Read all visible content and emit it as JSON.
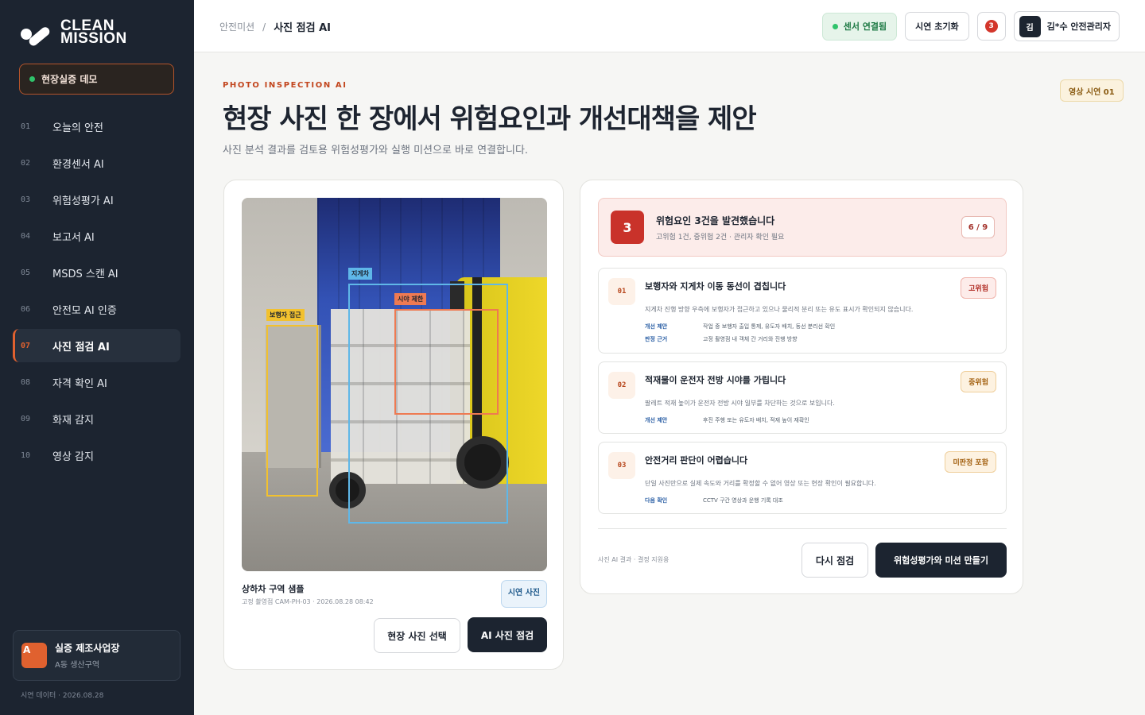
{
  "brand": {
    "line1": "CLEAN",
    "line2": "MISSION"
  },
  "demo_chip": "현장실증 데모",
  "nav": [
    {
      "num": "01",
      "label": "오늘의 안전"
    },
    {
      "num": "02",
      "label": "환경센서 AI"
    },
    {
      "num": "03",
      "label": "위험성평가 AI"
    },
    {
      "num": "04",
      "label": "보고서 AI"
    },
    {
      "num": "05",
      "label": "MSDS 스캔 AI"
    },
    {
      "num": "06",
      "label": "안전모 AI 인증"
    },
    {
      "num": "07",
      "label": "사진 점검 AI",
      "active": true
    },
    {
      "num": "08",
      "label": "자격 확인 AI"
    },
    {
      "num": "09",
      "label": "화재 감지"
    },
    {
      "num": "10",
      "label": "영상 감지"
    }
  ],
  "site": {
    "avatar": "A",
    "name": "실증 제조사업장",
    "sub": "A동 생산구역"
  },
  "sidebar_footer": "시연 데이터 · 2026.08.28",
  "breadcrumb": {
    "parent": "안전미션",
    "sep": "/",
    "current": "사진 점검 AI"
  },
  "top": {
    "sensor": "센서 연결됨",
    "reset": "시연 초기화",
    "notifications": "3",
    "user_avatar": "김",
    "user_name": "김*수 안전관리자"
  },
  "header": {
    "eyebrow": "PHOTO INSPECTION AI",
    "title": "현장 사진 한 장에서 위험요인과 개선대책을 제안",
    "subtitle": "사진 분석 결과를 검토용 위험성평가와 실행 미션으로 바로 연결합니다.",
    "demo_badge": "영상 시연 01"
  },
  "photo": {
    "labels": {
      "pedestrian": "보행자 접근",
      "forklift": "지게차",
      "sight": "시야 제한"
    },
    "caption": "상하차 구역 샘플",
    "meta": "고정 촬영점 CAM-PH-03 · 2026.08.28 08:42",
    "badge": "시연 사진",
    "select_button": "현장 사진 선택",
    "inspect_button": "AI 사진 점검"
  },
  "summary": {
    "count": "3",
    "title": "위험요인 3건을 발견했습니다",
    "sub": "고위험 1건, 중위험 2건 · 관리자 확인 필요",
    "progress": "6 / 9"
  },
  "risks": [
    {
      "num": "01",
      "title": "보행자와 지게차 이동 동선이 겹칩니다",
      "level": "고위험",
      "desc": "지게차 진행 방향 우측에 보행자가 접근하고 있으나 물리적 분리 또는 유도 표시가 확인되지 않습니다.",
      "rows": [
        {
          "k": "개선 제안",
          "v": "작업 중 보행자 출입 통제, 유도자 배치, 동선 분리선 확인"
        },
        {
          "k": "판정 근거",
          "v": "고정 촬영점 내 객체 간 거리와 진행 방향"
        }
      ]
    },
    {
      "num": "02",
      "title": "적재물이 운전자 전방 시야를 가립니다",
      "level": "중위험",
      "desc": "팔레트 적재 높이가 운전자 전방 시야 일부를 차단하는 것으로 보입니다.",
      "rows": [
        {
          "k": "개선 제안",
          "v": "후진 주행 또는 유도자 배치, 적재 높이 재확인"
        }
      ]
    },
    {
      "num": "03",
      "title": "안전거리 판단이 어렵습니다",
      "level": "미판정 포함",
      "desc": "단일 사진만으로 실제 속도와 거리를 확정할 수 없어 영상 또는 현장 확인이 필요합니다.",
      "rows": [
        {
          "k": "다음 확인",
          "v": "CCTV 구간 영상과 운행 기록 대조"
        }
      ]
    }
  ],
  "result_footer": {
    "note": "사진 AI 결과 · 결정 지원용",
    "retry": "다시 점검",
    "make": "위험성평가와 미션 만들기"
  }
}
